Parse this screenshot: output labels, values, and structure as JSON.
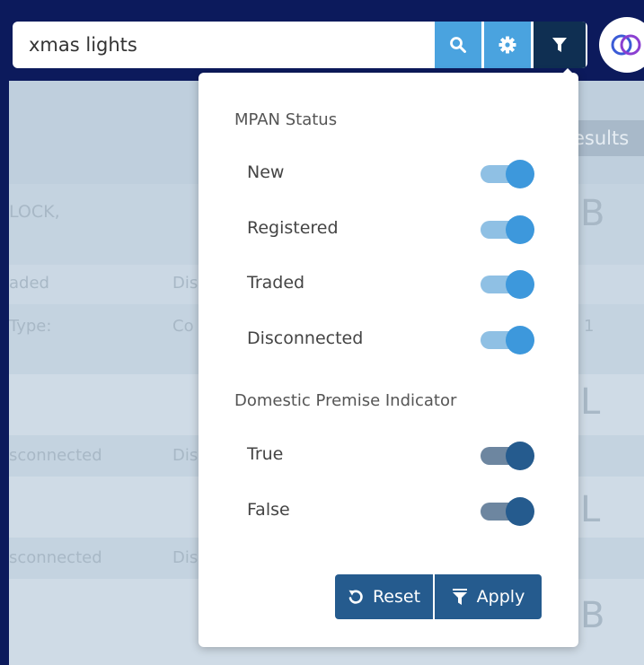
{
  "search": {
    "value": "xmas lights",
    "placeholder": ""
  },
  "toolbar": {
    "search_icon": "search-icon",
    "settings_icon": "gear-icon",
    "filter_icon": "filter-icon",
    "logo_icon": "overlapping-circles-logo"
  },
  "background": {
    "results_label": "esults",
    "row1_text": "LOCK,",
    "row1_code": "B",
    "row2_status": "aded",
    "row2_col2": "Dis",
    "row3_label": "Type:",
    "row3_col2": "Co",
    "row3_right": "1",
    "row4_code": "L",
    "row5_status": "sconnected",
    "row5_col2": "Dis",
    "row6_code": "L",
    "row7_status": "sconnected",
    "row7_col2": "Dis",
    "row8_code": "B"
  },
  "filter_panel": {
    "mpan_section": {
      "title": "MPAN Status",
      "options": [
        {
          "label": "New",
          "enabled": true
        },
        {
          "label": "Registered",
          "enabled": true
        },
        {
          "label": "Traded",
          "enabled": true
        },
        {
          "label": "Disconnected",
          "enabled": true
        }
      ]
    },
    "domestic_section": {
      "title": "Domestic Premise Indicator",
      "options": [
        {
          "label": "True",
          "enabled": true
        },
        {
          "label": "False",
          "enabled": true
        }
      ]
    },
    "reset_label": "Reset",
    "apply_label": "Apply"
  },
  "colors": {
    "page_bg": "#0c1a5c",
    "accent": "#4aa3df",
    "primary_dark": "#255b8e",
    "toggle_light": "#3d98dc"
  }
}
